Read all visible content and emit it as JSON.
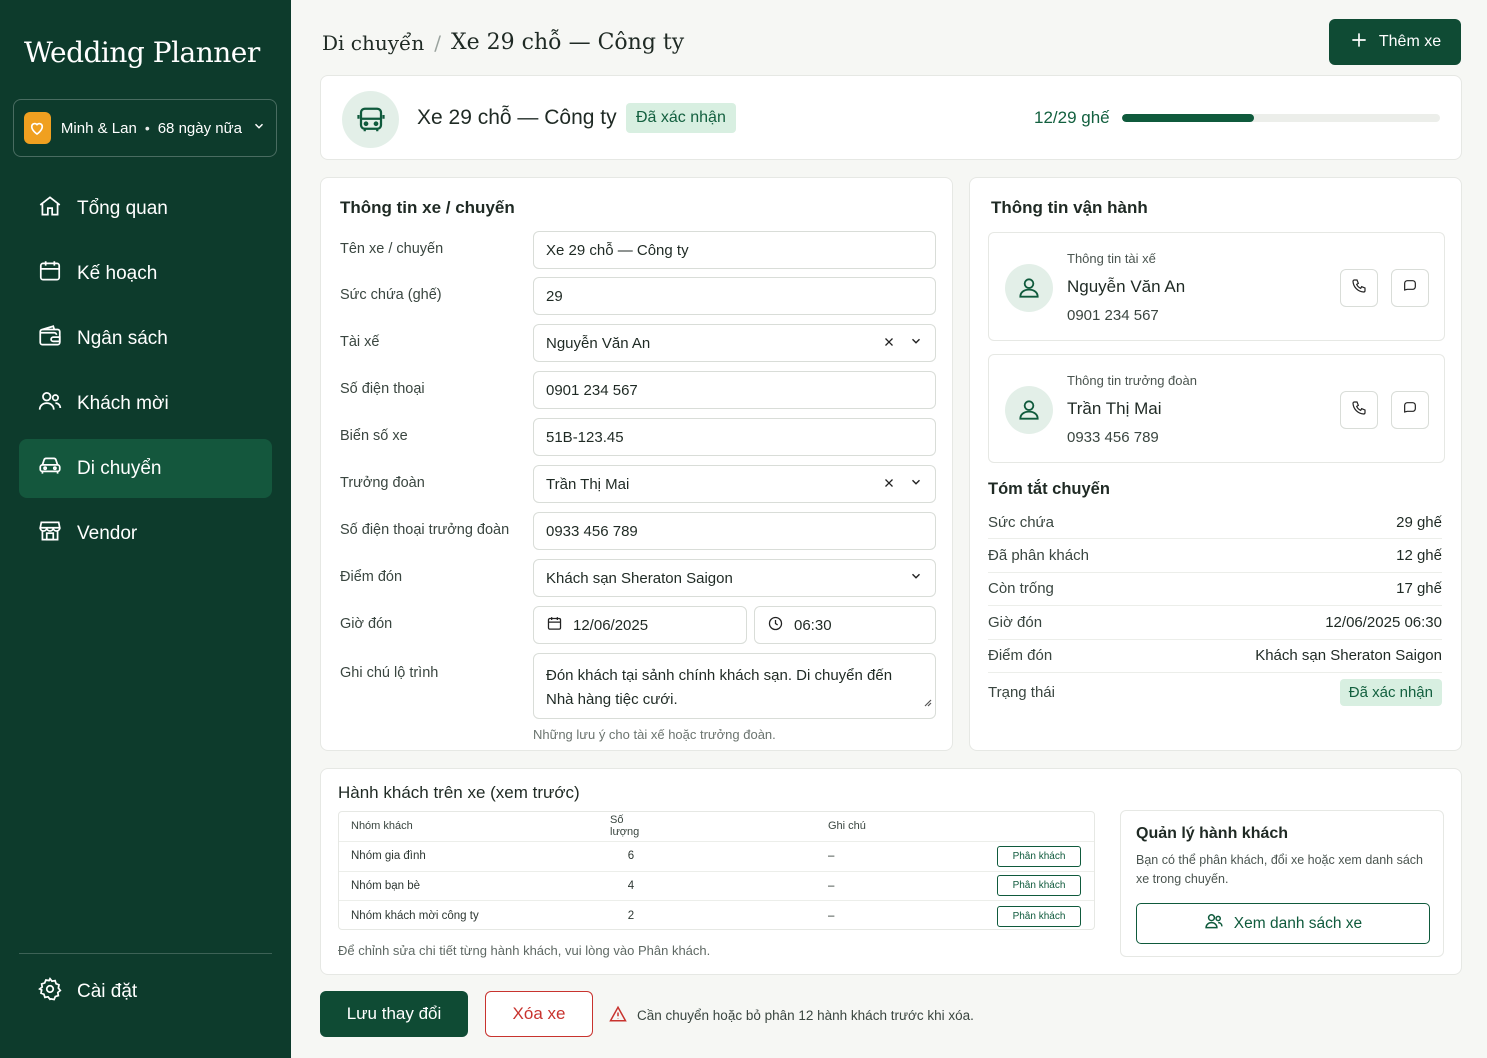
{
  "app": {
    "brand": "Wedding Planner"
  },
  "couple": {
    "names": "Minh & Lan",
    "countdown": "68 ngày nữa"
  },
  "nav": {
    "items": [
      {
        "label": "Tổng quan",
        "icon": "home-icon"
      },
      {
        "label": "Kế hoạch",
        "icon": "calendar-icon"
      },
      {
        "label": "Ngân sách",
        "icon": "wallet-icon"
      },
      {
        "label": "Khách mời",
        "icon": "users-icon"
      },
      {
        "label": "Di chuyển",
        "icon": "car-icon",
        "active": true
      },
      {
        "label": "Vendor",
        "icon": "store-icon"
      }
    ],
    "settings": "Cài đặt"
  },
  "header": {
    "crumb_parent": "Di chuyển",
    "separator": "/",
    "crumb_current": "Xe 29 chỗ — Công ty",
    "add_button": "Thêm xe"
  },
  "summary_bar": {
    "title": "Xe 29 chỗ — Công ty",
    "status": "Đã xác nhận",
    "seats_text": "12/29 ghế",
    "seats_filled_fraction": 0.414
  },
  "form": {
    "title": "Thông tin xe / chuyến",
    "fields": {
      "name": {
        "label": "Tên xe / chuyến",
        "value": "Xe 29 chỗ — Công ty"
      },
      "capacity": {
        "label": "Sức chứa (ghế)",
        "value": "29"
      },
      "driver": {
        "label": "Tài xế",
        "value": "Nguyễn Văn An"
      },
      "driver_phone": {
        "label": "Số điện thoại",
        "value": "0901 234 567"
      },
      "plate": {
        "label": "Biển số xe",
        "value": "51B-123.45"
      },
      "leader": {
        "label": "Trưởng đoàn",
        "value": "Trần Thị Mai"
      },
      "leader_phone": {
        "label": "Số điện thoại trưởng đoàn",
        "value": "0933 456 789"
      },
      "pickup_point": {
        "label": "Điểm đón",
        "value": "Khách sạn Sheraton Saigon"
      },
      "pickup_time": {
        "label": "Giờ đón",
        "date": "12/06/2025",
        "time": "06:30"
      },
      "route_note": {
        "label": "Ghi chú lộ trình",
        "value": "Đón khách tại sảnh chính khách sạn. Di chuyển đến Nhà hàng tiệc cưới."
      }
    },
    "helper": "Những lưu ý cho tài xế hoặc trưởng đoàn."
  },
  "operations": {
    "title": "Thông tin vận hành",
    "driver": {
      "role": "Thông tin tài xế",
      "name": "Nguyễn Văn An",
      "phone": "0901 234 567"
    },
    "leader": {
      "role": "Thông tin trưởng đoàn",
      "name": "Trần Thị Mai",
      "phone": "0933 456 789"
    },
    "summary_title": "Tóm tắt chuyến",
    "summary": [
      {
        "label": "Sức chứa",
        "value": "29 ghế"
      },
      {
        "label": "Đã phân khách",
        "value": "12 ghế"
      },
      {
        "label": "Còn trống",
        "value": "17 ghế"
      },
      {
        "label": "Giờ đón",
        "value": "12/06/2025 06:30"
      },
      {
        "label": "Điểm đón",
        "value": "Khách sạn Sheraton Saigon"
      }
    ],
    "status_label": "Trạng thái",
    "status_value": "Đã xác nhận"
  },
  "passengers": {
    "title": "Hành khách trên xe (xem trước)",
    "columns": [
      "Nhóm khách",
      "Số lượng",
      "Ghi chú"
    ],
    "rows": [
      {
        "group": "Nhóm gia đình",
        "count": "6",
        "note": "–",
        "action": "Phân khách"
      },
      {
        "group": "Nhóm bạn bè",
        "count": "4",
        "note": "–",
        "action": "Phân khách"
      },
      {
        "group": "Nhóm khách mời công ty",
        "count": "2",
        "note": "–",
        "action": "Phân khách"
      }
    ],
    "note": "Để chỉnh sửa chi tiết từng hành khách, vui lòng vào Phân khách.",
    "manage": {
      "title": "Quản lý hành khách",
      "desc": "Bạn có thể phân khách, đổi xe hoặc xem danh sách xe trong chuyến.",
      "button": "Xem danh sách xe"
    }
  },
  "footer": {
    "save": "Lưu thay đổi",
    "delete": "Xóa xe",
    "warning": "Cần chuyển hoặc bỏ phân 12 hành khách trước khi xóa."
  },
  "colors": {
    "primary": "#0f4b34",
    "sidebar": "#0d3b2c",
    "accent": "#f0a020",
    "danger": "#c8332e",
    "badge_bg": "#d8efe1"
  }
}
